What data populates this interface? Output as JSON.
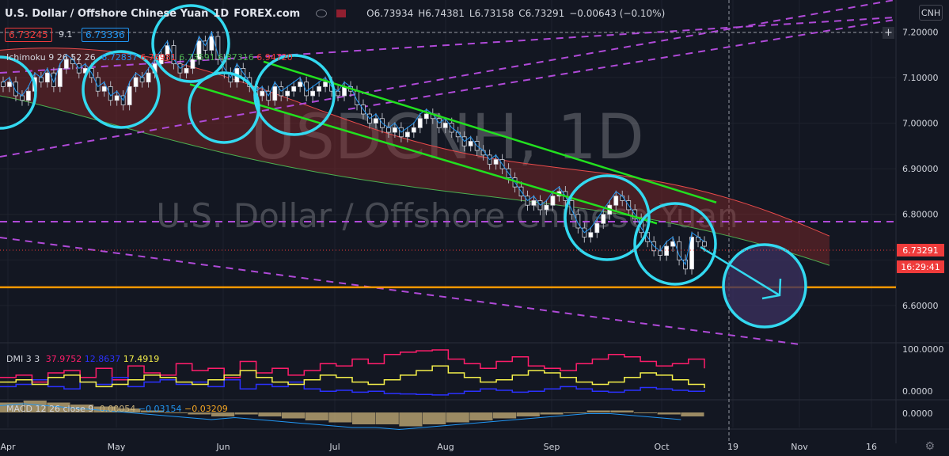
{
  "header": {
    "title": "U.S. Dollar / Offshore Chinese Yuan",
    "interval": "1D",
    "exchange": "FOREX.com",
    "open": "O6.73934",
    "high": "H6.74381",
    "low": "L6.73158",
    "close": "C6.73291",
    "change": "−0.00643 (−0.10%)",
    "currency_button": "CNH",
    "bid": "6.73245",
    "spread": "9.1",
    "ask": "6.73336"
  },
  "watermark": {
    "symbol_interval": "USDCNH, 1D",
    "description": "U.S. Dollar / Offshore Chinese Yuan"
  },
  "indicators": {
    "ichimoku_name": "Ichimoku 9 26 52 26",
    "ichimoku_values": [
      "6.72837",
      "6.76981",
      "6.73591",
      "6.87316",
      "6.94720"
    ],
    "dmi_name": "DMI 3 3",
    "dmi_values": [
      "37.9752",
      "12.8637",
      "17.4919"
    ],
    "macd_name": "MACD 12 26 close 9",
    "macd_values": [
      "0.00054",
      "−0.03154",
      "−0.03209"
    ]
  },
  "price_badges": {
    "last_price": "6.73291",
    "countdown": "16:29:41"
  },
  "colors": {
    "background": "#131722",
    "up_candle": "#ffffff",
    "down_candle": "#e0e3eb",
    "channel_line": "#22e01f",
    "support_line": "#ff9800",
    "purple_dash": "#b04ad8",
    "circle": "#33d9f0",
    "cloud_red": "#8a2a2a",
    "cloud_green": "#1f5a2a",
    "dmi_plus": "#ff1d6b",
    "dmi_minus": "#2b31ff",
    "adx": "#f5f04a",
    "macd_hist": "#c9b27a",
    "last_price_bg": "#ef3b3b"
  },
  "chart_data": {
    "type": "candlestick",
    "title": "U.S. Dollar / Offshore Chinese Yuan",
    "x_ticks": [
      "Apr",
      "May",
      "Jun",
      "Jul",
      "Aug",
      "Sep",
      "Oct",
      "19",
      "Nov",
      "16"
    ],
    "y_ticks": [
      "7.20000",
      "7.10000",
      "7.00000",
      "6.90000",
      "6.80000",
      "6.60000"
    ],
    "ylim": [
      6.52,
      7.27
    ],
    "series": [
      {
        "name": "Ichimoku 9 26 52 26"
      }
    ],
    "closes": [
      7.08,
      7.09,
      7.06,
      7.05,
      7.07,
      7.1,
      7.09,
      7.11,
      7.08,
      7.12,
      7.14,
      7.13,
      7.11,
      7.12,
      7.1,
      7.07,
      7.08,
      7.05,
      7.06,
      7.04,
      7.08,
      7.1,
      7.09,
      7.11,
      7.13,
      7.15,
      7.17,
      7.13,
      7.11,
      7.12,
      7.14,
      7.18,
      7.16,
      7.19,
      7.14,
      7.11,
      7.09,
      7.12,
      7.1,
      7.08,
      7.06,
      7.07,
      7.05,
      7.08,
      7.06,
      7.07,
      7.08,
      7.09,
      7.06,
      7.07,
      7.08,
      7.09,
      7.07,
      7.06,
      7.08,
      7.07,
      7.04,
      7.02,
      7.0,
      7.01,
      6.99,
      6.98,
      6.99,
      6.97,
      6.98,
      6.99,
      7.01,
      7.02,
      7.01,
      6.99,
      7.0,
      6.98,
      6.97,
      6.95,
      6.96,
      6.94,
      6.93,
      6.91,
      6.92,
      6.9,
      6.88,
      6.86,
      6.84,
      6.82,
      6.83,
      6.81,
      6.82,
      6.84,
      6.85,
      6.83,
      6.8,
      6.77,
      6.75,
      6.76,
      6.78,
      6.8,
      6.82,
      6.84,
      6.83,
      6.81,
      6.79,
      6.76,
      6.74,
      6.72,
      6.71,
      6.73,
      6.74,
      6.7,
      6.68,
      6.75,
      6.74,
      6.73
    ],
    "channel_upper_line": [
      [
        7.11,
        6.83
      ]
    ],
    "channel_lower_line": [
      [
        7.08,
        6.76
      ]
    ],
    "support_level": 6.64,
    "macd_hist": [
      0.05,
      0.06,
      0.05,
      0.04,
      0.03,
      0.02,
      0.01,
      0.0,
      -0.01,
      -0.02,
      -0.01,
      -0.02,
      -0.03,
      -0.04,
      -0.05,
      -0.06,
      -0.06,
      -0.07,
      -0.06,
      -0.05,
      -0.04,
      -0.03,
      -0.02,
      -0.01,
      0.0,
      0.01,
      0.01,
      0.0,
      -0.01,
      -0.02
    ],
    "dmi_plus": [
      40,
      45,
      30,
      50,
      55,
      40,
      60,
      35,
      65,
      50,
      45,
      70,
      55,
      60,
      40,
      75,
      50,
      60,
      45,
      55,
      70,
      65,
      80,
      70,
      90,
      95,
      98,
      100,
      80,
      70,
      60,
      75,
      85,
      65,
      60,
      55,
      70,
      80,
      90,
      85,
      75,
      65,
      70,
      80,
      60
    ],
    "dmi_minus": [
      20,
      25,
      35,
      20,
      15,
      30,
      25,
      40,
      20,
      30,
      35,
      25,
      30,
      20,
      35,
      15,
      25,
      20,
      30,
      15,
      10,
      12,
      8,
      10,
      5,
      4,
      3,
      2,
      5,
      10,
      15,
      12,
      8,
      10,
      15,
      20,
      15,
      10,
      8,
      12,
      18,
      15,
      12,
      10,
      13
    ],
    "adx": [
      30,
      35,
      25,
      40,
      45,
      30,
      20,
      25,
      35,
      45,
      40,
      30,
      25,
      35,
      45,
      55,
      40,
      30,
      25,
      35,
      45,
      40,
      30,
      25,
      35,
      45,
      55,
      65,
      50,
      40,
      30,
      35,
      45,
      55,
      50,
      40,
      30,
      25,
      30,
      40,
      50,
      45,
      35,
      25,
      17
    ]
  }
}
